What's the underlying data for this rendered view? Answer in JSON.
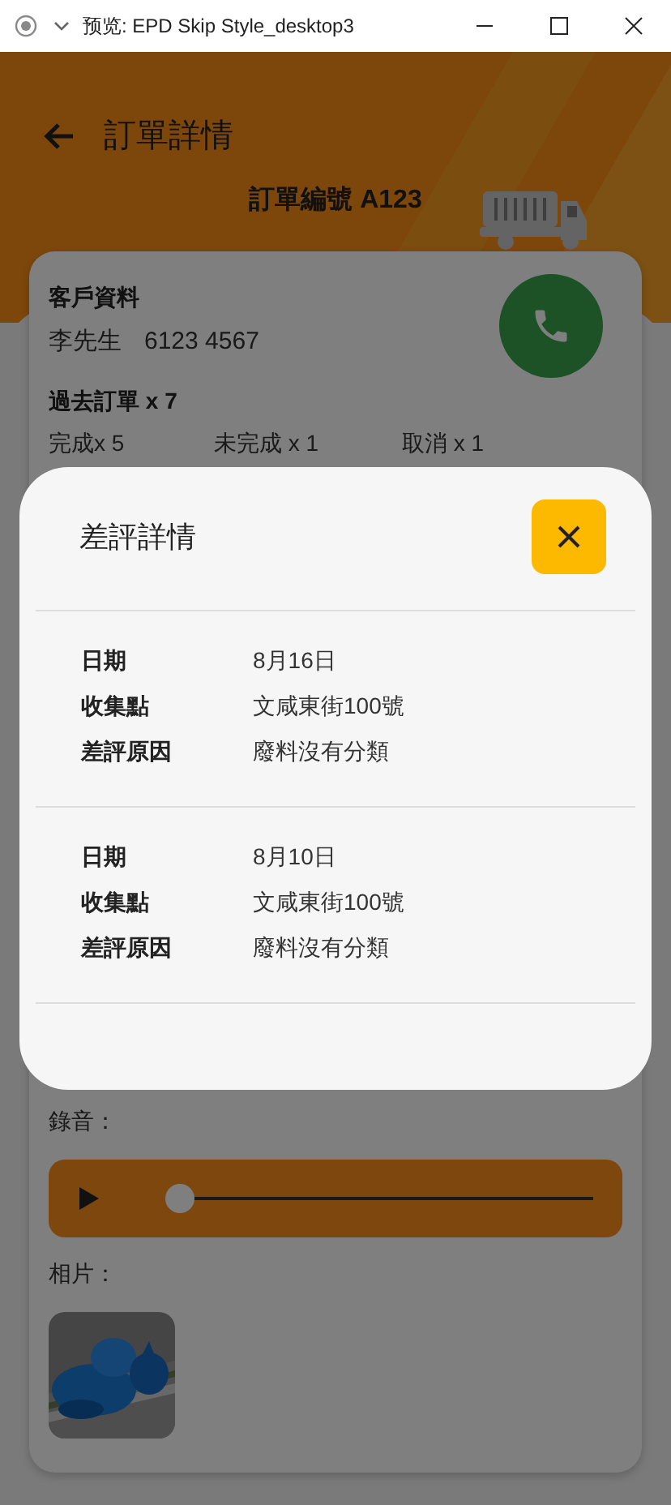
{
  "window": {
    "title": "预览: EPD Skip Style_desktop3"
  },
  "header": {
    "title": "訂單詳情",
    "order_number": "訂單編號 A123"
  },
  "customer": {
    "heading": "客戶資料",
    "name": "李先生",
    "phone": "6123 4567"
  },
  "past_orders": {
    "heading": "過去訂單 x 7",
    "stats": [
      "完成x 5",
      "未完成 x 1",
      "取消 x 1"
    ]
  },
  "recording": {
    "label": "錄音：",
    "level": 0
  },
  "photos": {
    "label": "相片："
  },
  "dialog": {
    "title": "差評詳情",
    "entries": [
      {
        "fields": [
          {
            "label": "日期",
            "value": "8月16日"
          },
          {
            "label": "收集點",
            "value": "文咸東街100號"
          },
          {
            "label": "差評原因",
            "value": "廢料沒有分類"
          }
        ]
      },
      {
        "fields": [
          {
            "label": "日期",
            "value": "8月10日"
          },
          {
            "label": "收集點",
            "value": "文咸東街100號"
          },
          {
            "label": "差評原因",
            "value": "廢料沒有分類"
          }
        ]
      }
    ]
  }
}
